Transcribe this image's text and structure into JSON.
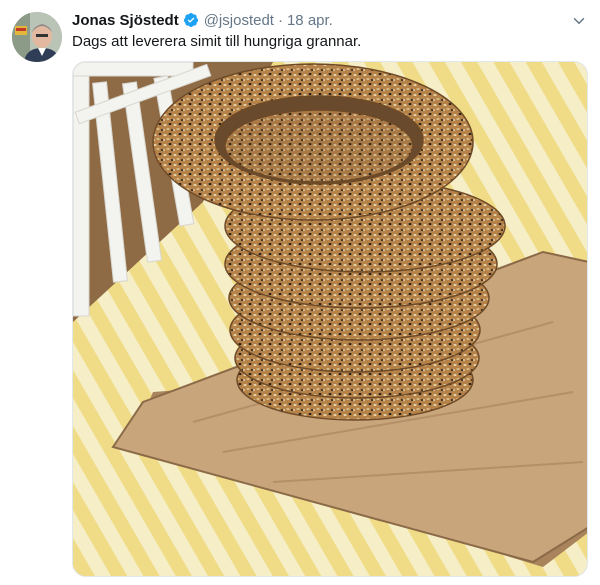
{
  "tweet": {
    "author_name": "Jonas Sjöstedt",
    "handle": "@jsjostedt",
    "separator": "·",
    "date": "18 apr.",
    "text": "Dags att leverera simit till hungriga grannar."
  },
  "icons": {
    "verified": "verified-badge-icon",
    "menu": "chevron-down-icon"
  },
  "colors": {
    "verified_blue": "#1da1f2",
    "secondary_text": "#657786",
    "primary_text": "#14171a"
  },
  "media": {
    "alt": "Stack of sesame-seed simit bread rings on a wooden cutting board"
  }
}
